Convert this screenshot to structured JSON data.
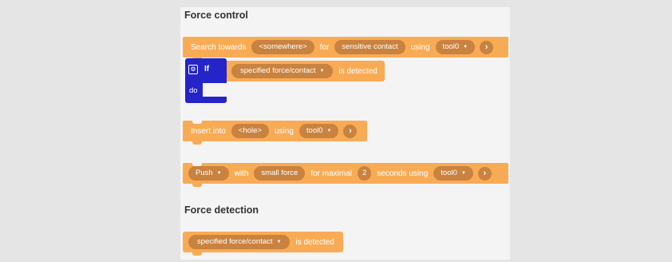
{
  "force_control": {
    "heading": "Force control",
    "search_block": {
      "verb": "Search towards",
      "target": "<somewhere>",
      "for_label": "for",
      "mode": "sensitive contact",
      "using_label": "using",
      "tool": "tool0",
      "arrow": "›"
    },
    "if_block": {
      "if_label": "If",
      "do_label": "do",
      "condition": "specified force/contact",
      "suffix": "is detected",
      "gear": "⚙"
    },
    "insert_block": {
      "verb": "Insert into",
      "target": "<hole>",
      "using_label": "using",
      "tool": "tool0",
      "arrow": "›"
    },
    "push_block": {
      "action": "Push",
      "with_label": "with",
      "force": "small force",
      "for_label": "for maximal",
      "seconds": "2",
      "seconds_label": "seconds using",
      "tool": "tool0",
      "arrow": "›"
    }
  },
  "force_detection": {
    "heading": "Force detection",
    "detect_block": {
      "condition": "specified force/contact",
      "suffix": "is detected"
    }
  },
  "colors": {
    "background": "#e5e5e5",
    "panel": "#f4f4f4",
    "block_orange": "#f8ab55",
    "pill_brown": "#c9823f",
    "if_blue": "#2424c8"
  }
}
